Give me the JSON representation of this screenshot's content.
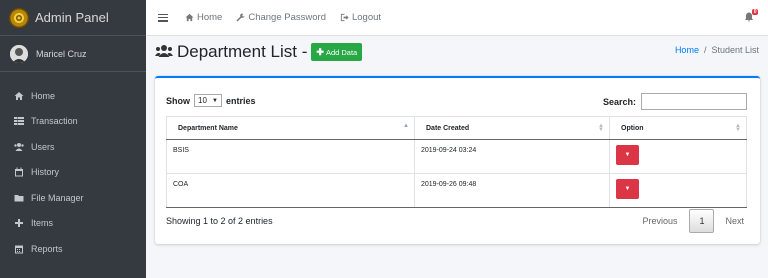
{
  "sidebar": {
    "brand": "Admin Panel",
    "user_name": "Maricel Cruz",
    "items": [
      {
        "label": "Home",
        "icon": "home-icon"
      },
      {
        "label": "Transaction",
        "icon": "table-icon"
      },
      {
        "label": "Users",
        "icon": "users-icon"
      },
      {
        "label": "History",
        "icon": "calendar-icon"
      },
      {
        "label": "File Manager",
        "icon": "folder-icon"
      },
      {
        "label": "Items",
        "icon": "plus-icon"
      },
      {
        "label": "Reports",
        "icon": "calendar-grid-icon"
      }
    ]
  },
  "topbar": {
    "home": "Home",
    "change_password": "Change Password",
    "logout": "Logout",
    "notification_count": "0"
  },
  "header": {
    "title": "Department List -",
    "add_button": "Add Data",
    "breadcrumb_home": "Home",
    "breadcrumb_sep": "/",
    "breadcrumb_current": "Student List"
  },
  "table_controls": {
    "show_label": "Show",
    "page_length": "10",
    "entries_label": "entries",
    "search_label": "Search:"
  },
  "table": {
    "columns": [
      "Department Name",
      "Date Created",
      "Option"
    ],
    "rows": [
      {
        "name": "BSIS",
        "date": "2019-09-24 03:24"
      },
      {
        "name": "COA",
        "date": "2019-09-26 09:48"
      }
    ]
  },
  "footer": {
    "info": "Showing 1 to 2 of 2 entries",
    "previous": "Previous",
    "page": "1",
    "next": "Next"
  },
  "colors": {
    "sidebar_bg": "#343a40",
    "primary": "#007bff",
    "success": "#28a745",
    "danger": "#dc3545"
  }
}
